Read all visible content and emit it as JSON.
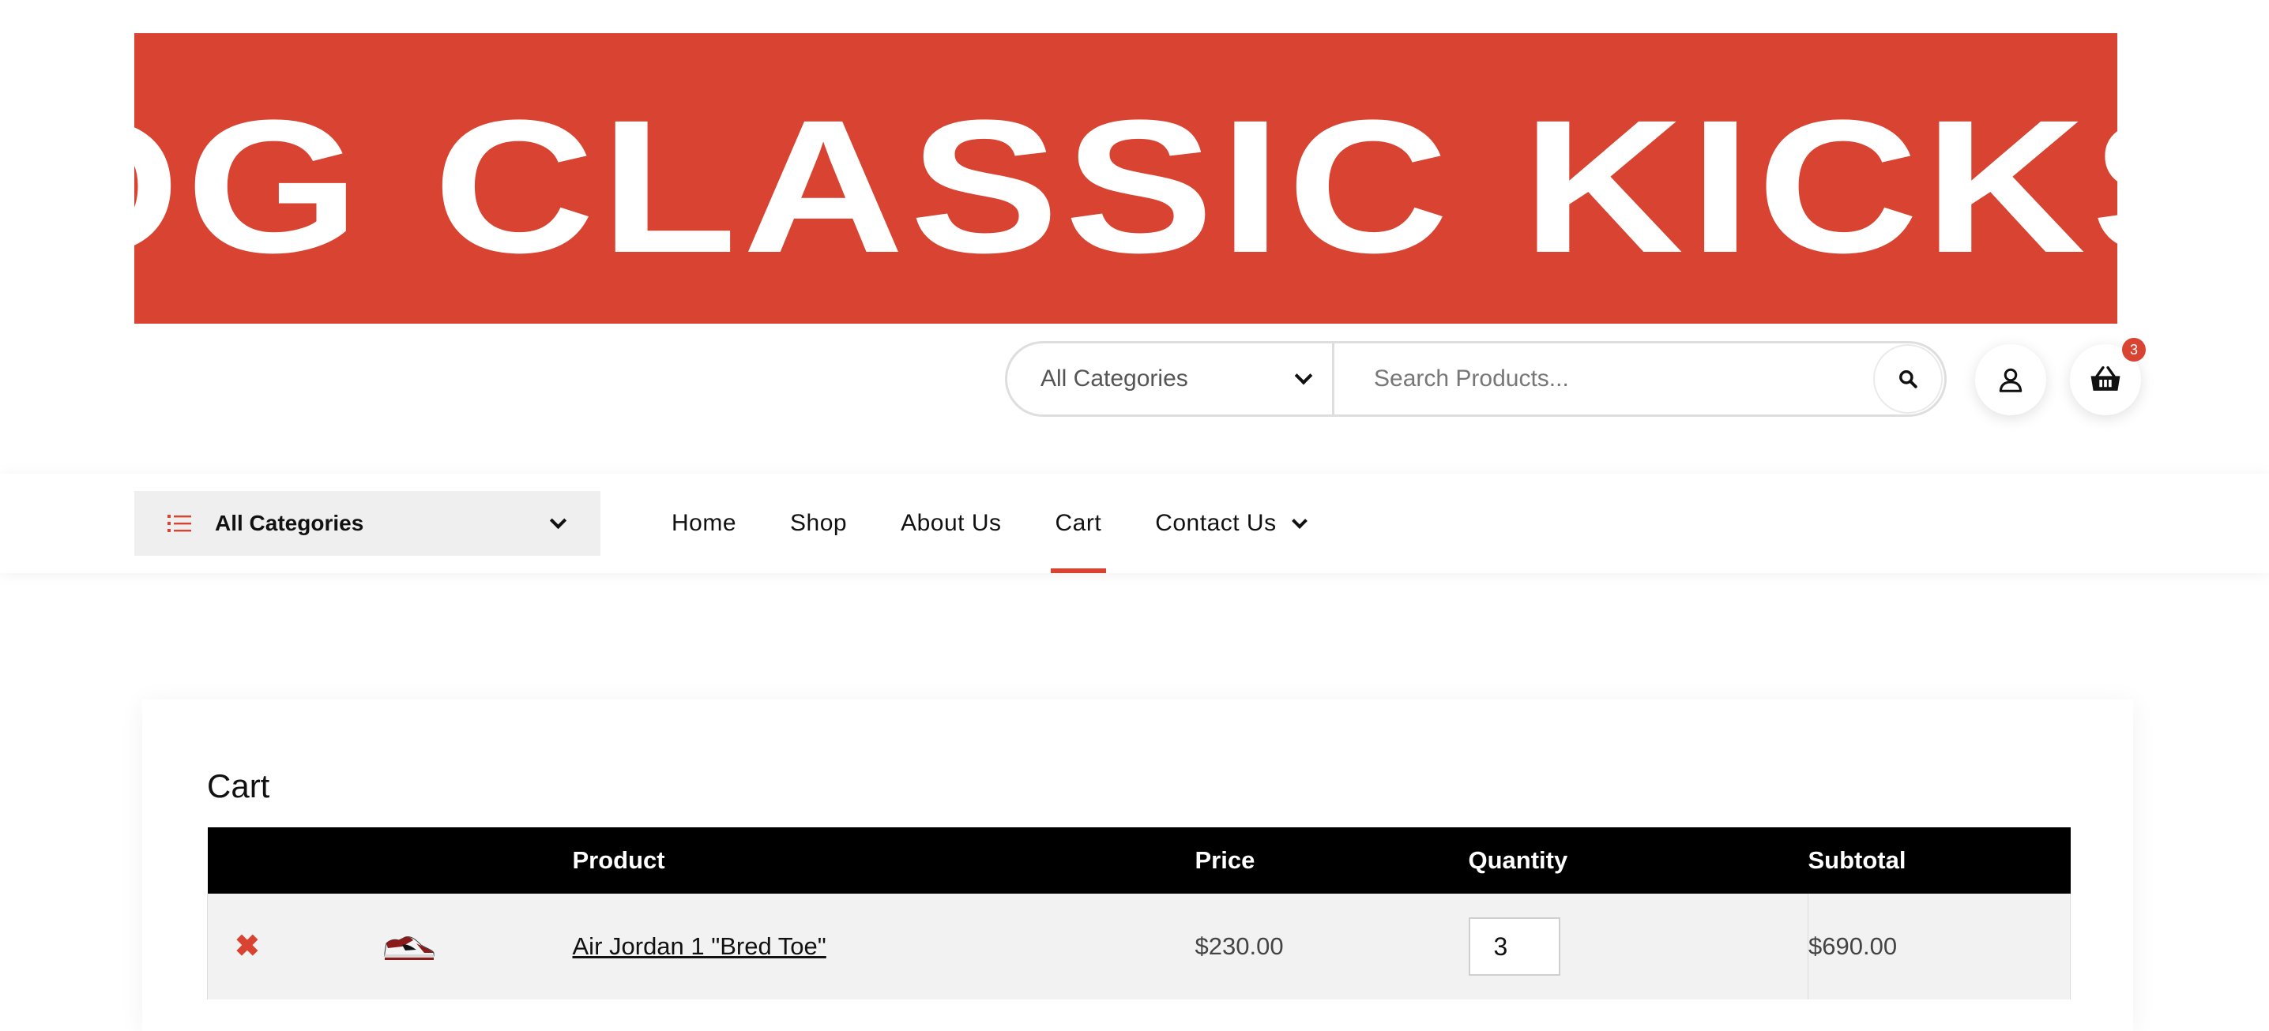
{
  "banner": {
    "text": "OG CLASSIC KICKS",
    "bg_color": "#D94432"
  },
  "header": {
    "category_select": "All Categories",
    "search_placeholder": "Search Products...",
    "search_icon": "search-icon",
    "account_icon": "user-icon",
    "cart_icon": "basket-icon",
    "cart_count": "3"
  },
  "nav": {
    "categories_label": "All Categories",
    "links": [
      {
        "label": "Home",
        "active": false
      },
      {
        "label": "Shop",
        "active": false
      },
      {
        "label": "About Us",
        "active": false
      },
      {
        "label": "Cart",
        "active": true
      },
      {
        "label": "Contact Us",
        "active": false,
        "has_dropdown": true
      }
    ],
    "accent_color": "#D94432"
  },
  "cart": {
    "title": "Cart",
    "headers": {
      "remove": "",
      "thumbnail": "",
      "product": "Product",
      "price": "Price",
      "quantity": "Quantity",
      "subtotal": "Subtotal"
    },
    "items": [
      {
        "product": "Air Jordan 1 \"Bred Toe\"",
        "price": "$230.00",
        "quantity": "3",
        "subtotal": "$690.00",
        "remove_icon": "close-icon",
        "thumbnail_icon": "sneaker-thumbnail"
      }
    ]
  }
}
